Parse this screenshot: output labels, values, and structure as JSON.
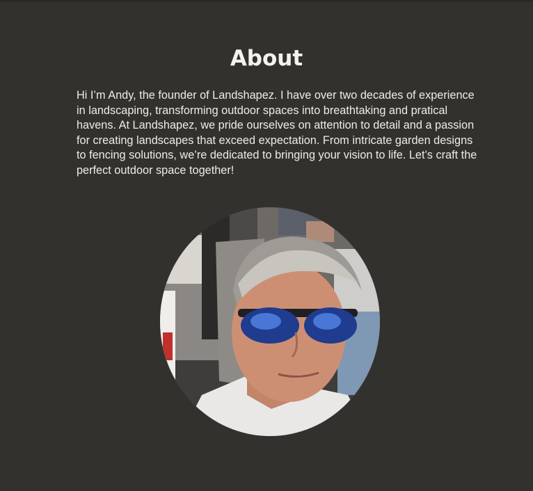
{
  "about": {
    "heading": "About",
    "bio": "Hi I’m Andy, the founder of Landshapez. I have over two decades of experience in landscaping, transforming outdoor spaces into breathtaking and pratical havens. At Landshapez, we pride ourselves on attention to detail and a passion for creating landscapes that exceed expectation. From intricate garden designs to fencing solutions, we’re dedicated to bringing your vision to life. Let’s craft the perfect outdoor space together!"
  },
  "portrait": {
    "alt": "portrait-photo"
  },
  "colors": {
    "background": "#33312e",
    "text": "#f1efe9"
  }
}
